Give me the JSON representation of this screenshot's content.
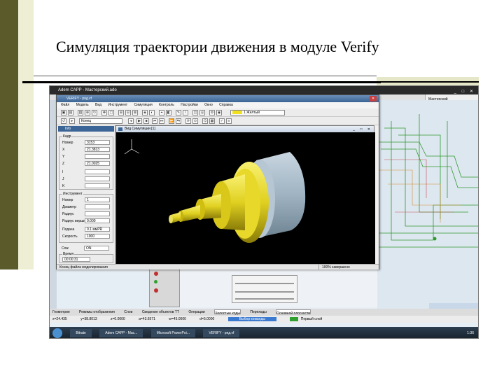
{
  "slide": {
    "title": "Симуляция траектории движения в модуле Verify"
  },
  "app": {
    "window_title": "Adem CAPP - Мастерский.ado",
    "right_pane_label": "Мастерский",
    "taskbar": {
      "items": [
        "Bitrate",
        "Adem CAPP - Мас...",
        "Microsoft PowerPoi...",
        "VERIFY - ряд.vf"
      ],
      "clock": "1:36"
    },
    "bottom_toolbar": {
      "geometry_label": "Геометрия",
      "view_label": "Режимы отображения",
      "layers_label": "Слои",
      "select_label": "Сведение объектов ТТ",
      "operation_label": "Операции",
      "operation_value": "Холостые ходы",
      "transition_label": "Переходы",
      "transition_value": "Основной плоскости"
    },
    "status": {
      "x": "x=24.435",
      "y": "y=38.8013",
      "z": "z=0.0000",
      "a": "a=43.6571",
      "w": "w=45.0000",
      "d": "d=5.0000",
      "select_cmd": "Выбор команды",
      "layer": "Первый слой"
    }
  },
  "verify": {
    "window_title": "VERIFY - ряд.vf",
    "menu": [
      "Файл",
      "Модель",
      "Вид",
      "Инструмент",
      "Симуляция",
      "Контроль",
      "Настройки",
      "Окно",
      "Справка"
    ],
    "mode_value": "Конец",
    "color_value": "1 Желтый",
    "panel_title": "Info",
    "frame_group": "Кадр",
    "frame_number_label": "Номер",
    "frame_number": "3153",
    "x_label": "X",
    "x_value": "21.3813",
    "y_label": "Y",
    "z_label": "Z",
    "z_value": "21.0025",
    "i_label": "I",
    "j_label": "J",
    "k_label": "K",
    "tool_group": "Инструмент",
    "tool_number_label": "Номер",
    "tool_number": "1",
    "diameter_label": "Диаметр",
    "radius_label": "Радиус",
    "corner_label": "Радиус вершины",
    "corner_value": "0.000",
    "feed_label": "Подача",
    "feed_value": "0.1 ммPR",
    "speed_label": "Скорость",
    "speed_value": "1000",
    "spindle_label": "Сож",
    "spindle_value": "ON",
    "time_label": "Время",
    "time_value": "00:00:31",
    "sim_window_title": "Вид Симуляции [1]",
    "status_text": "Конец файла моделирования",
    "progress_text": "100% завершено"
  }
}
